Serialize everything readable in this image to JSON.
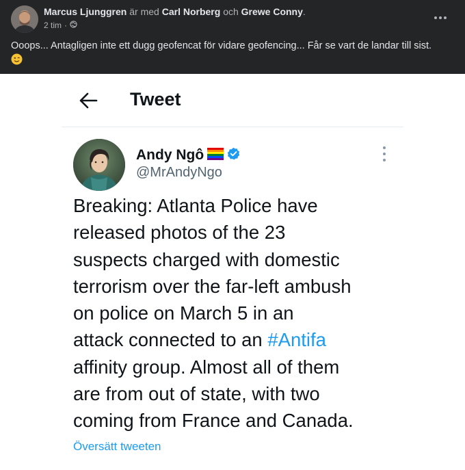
{
  "facebook_post": {
    "author": "Marcus Ljunggren",
    "with_text": "är med",
    "tagged_1": "Carl Norberg",
    "and_text": "och",
    "tagged_2": "Grewe Conny",
    "period": ".",
    "time": "2 tim",
    "separator": "·",
    "privacy_icon": "globe-icon",
    "text": "Ooops... Antagligen inte ett dugg geofencat för vidare geofencing... Får se vart de landar till sist.",
    "emoji": "winking-face-emoji",
    "menu_icon": "more-horizontal-icon"
  },
  "tweet": {
    "header_title": "Tweet",
    "back_icon": "arrow-left-icon",
    "author_name": "Andy Ngô",
    "handle": "@MrAndyNgo",
    "flag_icon": "rainbow-flag-icon",
    "verified_icon": "verified-badge-icon",
    "more_icon": "more-vertical-icon",
    "body_lines": [
      "Breaking: Atlanta Police have",
      "released photos of the 23",
      "suspects charged with domestic",
      "terrorism over the far-left ambush",
      "on police on March 5 in an",
      "attack connected to an ",
      "affinity group. Almost all of them",
      "are from out of state, with two",
      "coming from France and Canada."
    ],
    "hashtag": "#Antifa",
    "translate_link": "Översätt tweeten"
  },
  "colors": {
    "fb_background": "#242526",
    "fb_text": "#e4e6eb",
    "fb_secondary": "#b0b3b8",
    "twitter_blue": "#1d9bf0",
    "tweet_text": "#0f1419",
    "handle_gray": "#536471"
  }
}
